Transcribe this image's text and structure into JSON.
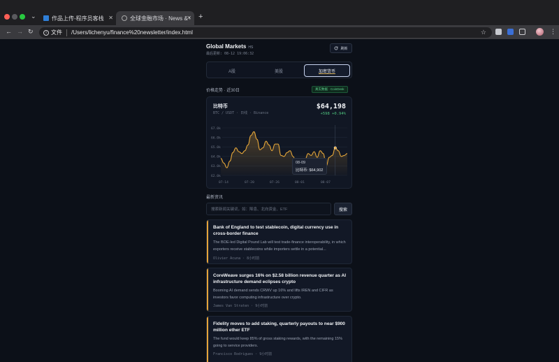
{
  "browser": {
    "tabs": [
      {
        "title": "作品上传-程序员客栈"
      },
      {
        "title": "全球金融市场 · News & Charts"
      }
    ],
    "address": {
      "scheme_label": "文件",
      "url": "/Users/lichenyu/finance%20newsletter/index.html"
    }
  },
  "header": {
    "title": "Global Markets",
    "badge": "HS",
    "last_updated": "最后更新: 08-12 19:06:32",
    "refresh_label": "刷新"
  },
  "segments": [
    {
      "label": "A股",
      "active": false
    },
    {
      "label": "美股",
      "active": false
    },
    {
      "label": "加密货币",
      "active": true
    }
  ],
  "price_section": {
    "label": "价格走势 · 近30日",
    "badge": "真实数据 · CoinDesk"
  },
  "asset": {
    "name": "比特币",
    "pair": "BTC / USDT · 日线 · Binance",
    "price": "$64,198",
    "change": "+598 +0.94%"
  },
  "tooltip": {
    "date": "08-09",
    "label": "比特币: $64,902"
  },
  "chart_data": {
    "type": "area",
    "y_ticks": [
      "67.0k",
      "66.0k",
      "65.0k",
      "64.0k",
      "63.0k",
      "62.0k"
    ],
    "x_ticks": [
      "07-14",
      "07-20",
      "07-26",
      "08-01",
      "08-07"
    ],
    "ylim": [
      62000,
      67000
    ],
    "series": [
      {
        "name": "比特币",
        "values": [
          63800,
          63300,
          62800,
          63500,
          64400,
          64900,
          64500,
          64300,
          64600,
          65200,
          66200,
          66600,
          65800,
          64700,
          64900,
          65600,
          65200,
          64600,
          65300,
          65300,
          64100,
          64000,
          64400,
          64600,
          64000,
          63300,
          62200,
          63200,
          63700,
          64300,
          64100,
          64500,
          63900,
          64600,
          64300,
          63000,
          63900,
          64100,
          64900,
          64600,
          64000,
          64100,
          64300
        ]
      }
    ],
    "color": "#e8a83a",
    "grid": true
  },
  "news_section": {
    "label": "最新资讯"
  },
  "search": {
    "placeholder": "搜索新闻关键词，如：降息、北向资金、ETF",
    "button": "搜索"
  },
  "news": [
    {
      "title": "Bank of England to test stablecoin, digital currency use in cross-border finance",
      "desc": "The BOE-led Digital Pound Lab will test trade-finance interoperability, in which exporters receive stablecoins while importers settle in a potential...",
      "meta": "Olivier Acuna · 8小时前"
    },
    {
      "title": "CoreWeave surges 16% on $2.58 billion revenue quarter as AI infrastructure demand eclipses crypto",
      "desc": "Booming AI demand sends CRWV up 16% and lifts IREN and CIFR as investors favor computing infrastructure over crypto.",
      "meta": "James Van Straten · 9小时前"
    },
    {
      "title": "Fidelity moves to add staking, quarterly payouts to near $900 million ether ETF",
      "desc": "The fund would keep 85% of gross staking rewards, with the remaining 15% going to service providers.",
      "meta": "Francisco Rodrigues · 9小时前"
    }
  ]
}
